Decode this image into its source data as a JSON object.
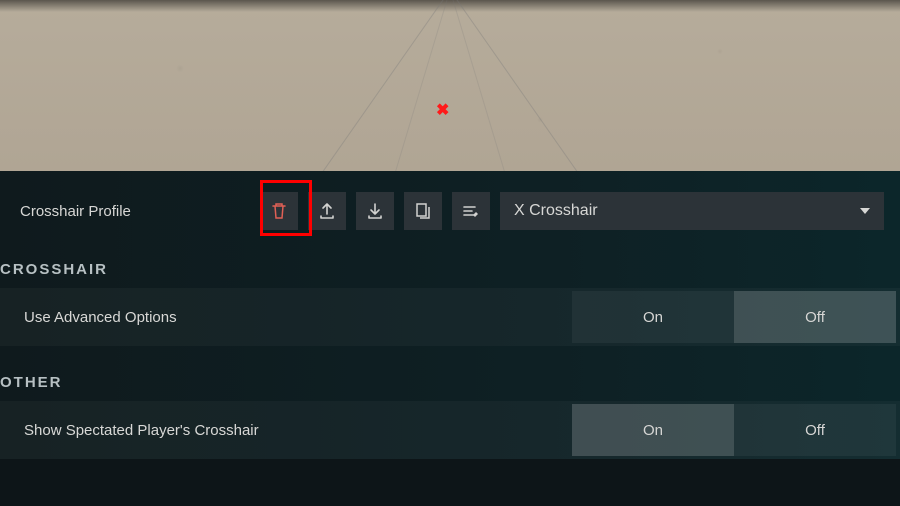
{
  "profile": {
    "label": "Crosshair Profile",
    "selected": "X Crosshair"
  },
  "sections": {
    "crosshair": {
      "title": "CROSSHAIR"
    },
    "other": {
      "title": "OTHER"
    }
  },
  "options": {
    "advanced": {
      "label": "Use Advanced Options",
      "on": "On",
      "off": "Off"
    },
    "spectated": {
      "label": "Show Spectated Player's Crosshair",
      "on": "On",
      "off": "Off"
    }
  },
  "icons": {
    "delete": "delete-icon",
    "export": "export-icon",
    "import": "import-icon",
    "copy": "copy-icon",
    "edit": "edit-icon"
  },
  "colors": {
    "accent_red": "#ff0000",
    "bg_dark": "#0d1518",
    "btn_bg": "#2c3338"
  }
}
